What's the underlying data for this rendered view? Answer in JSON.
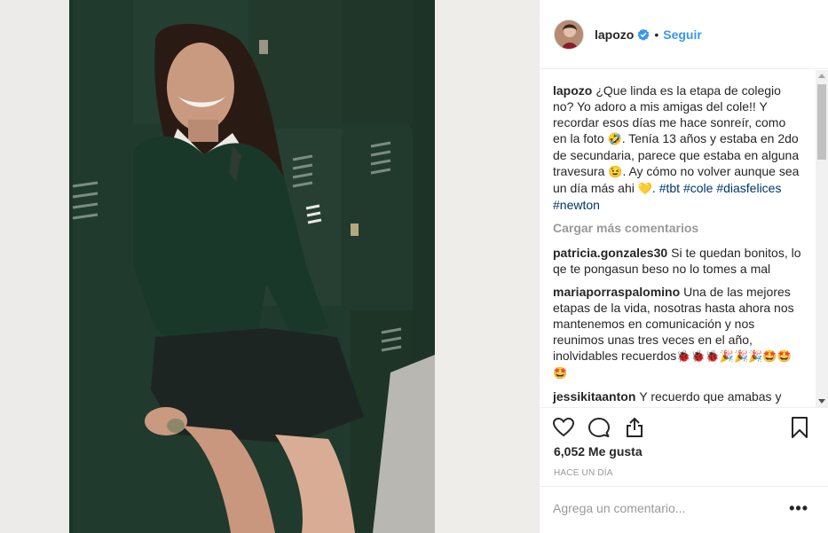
{
  "post": {
    "username": "lapozo",
    "verified": true,
    "follow_label": "Seguir",
    "separator": "•"
  },
  "caption": {
    "username": "lapozo",
    "text_1": "¿Que linda es la etapa de colegio no? Yo adoro a mis amigas del cole!! Y recordar esos días me hace sonreír, como en la foto",
    "emoji_1": "🤣",
    "text_2": ". Tenía 13 años y estaba en 2do de secundaria, parece que estaba en alguna travesura",
    "emoji_2": "😉",
    "text_3": ". Ay cómo no volver aunque sea un día más ahi",
    "emoji_3": "💛",
    "text_4": ".",
    "hashtags": [
      "#tbt",
      "#cole",
      "#diasfelices",
      "#newton"
    ]
  },
  "load_more_label": "Cargar más comentarios",
  "comments": [
    {
      "username": "patricia.gonzales30",
      "text": "Si te quedan bonitos, lo qe te pongasun beso no lo tomes a mal"
    },
    {
      "username": "mariaporraspalomino",
      "text": "Una de las mejores etapas de la vida, nosotras hasta ahora nos mantenemos en comunicación y nos reunimos unas tres veces en el año, inolvidables recuerdos",
      "emojis": "🐞🐞🐞🎉🎉🎉🤩🤩🤩"
    },
    {
      "username": "jessikitaanton",
      "text": "Y recuerdo que amabas y eras fans de menudo.... Que épocas más"
    }
  ],
  "likes_label": "6,052 Me gusta",
  "time_ago": "HACE UN DÍA",
  "add_comment": {
    "placeholder": "Agrega un comentario..."
  },
  "more_options": "•••",
  "icons": {
    "like": "heart-icon",
    "comment": "comment-icon",
    "share": "share-icon",
    "save": "bookmark-icon",
    "verified": "verified-badge-icon"
  },
  "colors": {
    "link_blue": "#3897f0",
    "hashtag": "#003569",
    "muted": "#999999",
    "text": "#262626"
  }
}
